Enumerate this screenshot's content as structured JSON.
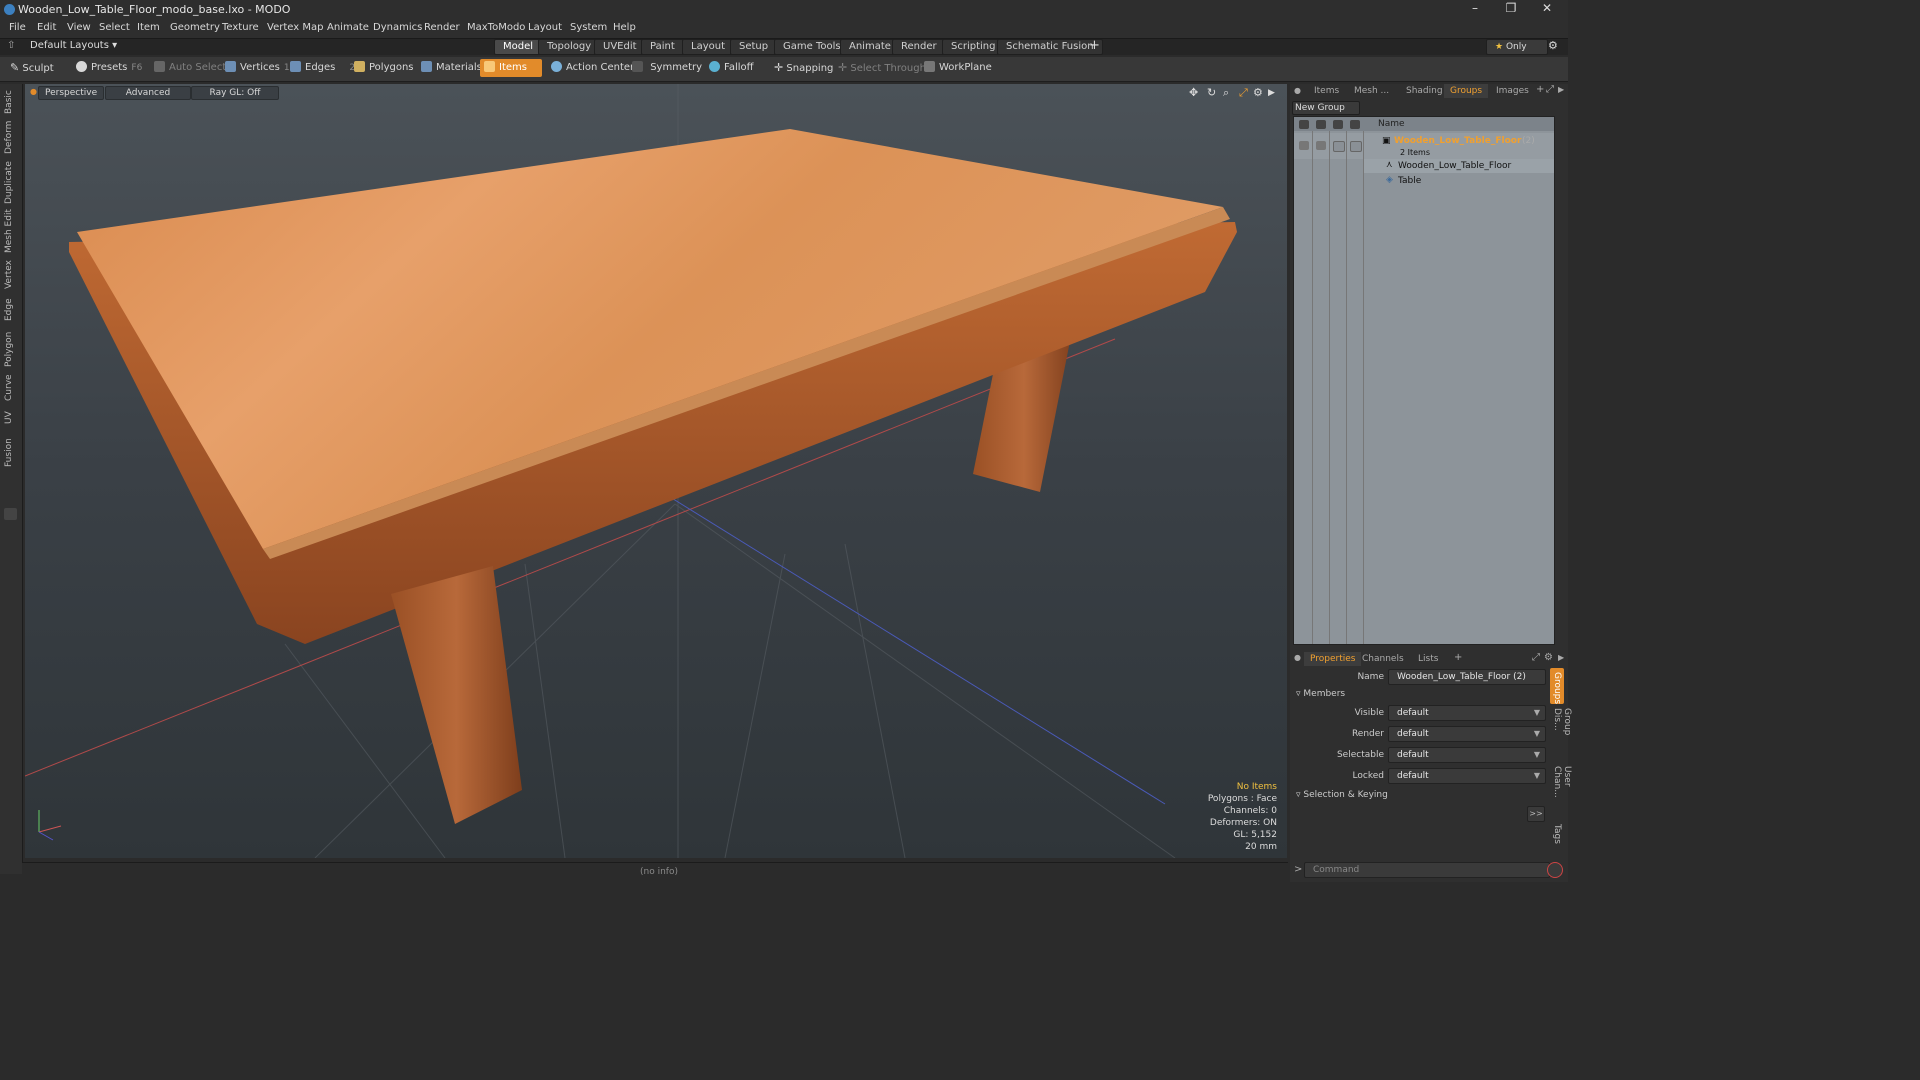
{
  "window": {
    "title": "Wooden_Low_Table_Floor_modo_base.lxo - MODO"
  },
  "menu": [
    "File",
    "Edit",
    "View",
    "Select",
    "Item",
    "Geometry",
    "Texture",
    "Vertex Map",
    "Animate",
    "Dynamics",
    "Render",
    "MaxToModo",
    "Layout",
    "System",
    "Help"
  ],
  "layoutbar": {
    "layout_dropdown": "Default Layouts",
    "tabs": [
      "Model",
      "Topology",
      "UVEdit",
      "Paint",
      "Layout",
      "Setup",
      "Game Tools",
      "Animate",
      "Render",
      "Scripting",
      "Schematic Fusion"
    ],
    "active_tab": "Model",
    "only_label": "Only"
  },
  "toolbar": {
    "sculpt": "Sculpt",
    "presets": "Presets",
    "presets_key": "F6",
    "auto_select": "Auto Select",
    "vertices": "Vertices",
    "vertices_count": "1",
    "edges": "Edges",
    "edges_count": "2",
    "polygons": "Polygons",
    "materials": "Materials",
    "items": "Items",
    "action_center": "Action Center",
    "symmetry": "Symmetry",
    "falloff": "Falloff",
    "snapping": "Snapping",
    "select_through": "Select Through",
    "workplane": "WorkPlane"
  },
  "left_tabs": [
    "Basic",
    "Deform",
    "Duplicate",
    "Mesh Edit",
    "Vertex",
    "Edge",
    "Polygon",
    "Curve",
    "UV",
    "Fusion"
  ],
  "viewport": {
    "view_mode": "Perspective",
    "shading": "Advanced",
    "raygl": "Ray GL: Off",
    "stats": {
      "items": "No Items",
      "polygons": "Polygons : Face",
      "channels": "Channels: 0",
      "deformers": "Deformers: ON",
      "gl": "GL: 5,152",
      "scale": "20 mm"
    }
  },
  "status": {
    "info": "(no info)"
  },
  "right_panel": {
    "tabs": [
      "Items",
      "Mesh ...",
      "Shading",
      "Groups",
      "Images"
    ],
    "active_tab": "Groups",
    "new_group": "New Group",
    "column_name": "Name",
    "group": {
      "name": "Wooden_Low_Table_Floor",
      "suffix": "(2)",
      "count": "2 Items"
    },
    "children": [
      "Wooden_Low_Table_Floor",
      "Table"
    ]
  },
  "properties": {
    "tabs": [
      "Properties",
      "Channels",
      "Lists"
    ],
    "active_tab": "Properties",
    "name_label": "Name",
    "name_value": "Wooden_Low_Table_Floor (2)",
    "members_section": "Members",
    "fields": [
      {
        "label": "Visible",
        "value": "default"
      },
      {
        "label": "Render",
        "value": "default"
      },
      {
        "label": "Selectable",
        "value": "default"
      },
      {
        "label": "Locked",
        "value": "default"
      }
    ],
    "selection_section": "Selection & Keying",
    "more_button": ">>",
    "side_tabs": [
      "Groups",
      "Group Dis...",
      "User Chan...",
      "Tags"
    ],
    "command_placeholder": "Command"
  },
  "colors": {
    "accent": "#e28b2a",
    "group_text": "#f0a030"
  }
}
